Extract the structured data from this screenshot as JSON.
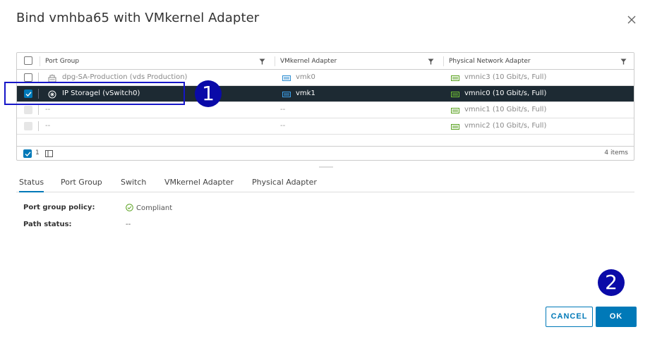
{
  "dialog": {
    "title": "Bind vmhba65 with VMkernel Adapter"
  },
  "grid": {
    "columns": [
      "Port Group",
      "VMkernel Adapter",
      "Physical Network Adapter"
    ],
    "rows": [
      {
        "port_group": "dpg-SA-Production (vds Production)",
        "vmkernel": "vmk0",
        "physical": "vmnic3 (10 Gbit/s, Full)",
        "checked": false,
        "selected": false,
        "disabled": false
      },
      {
        "port_group": "IP Storagel (vSwitch0)",
        "vmkernel": "vmk1",
        "physical": "vmnic0 (10 Gbit/s, Full)",
        "checked": true,
        "selected": true,
        "disabled": false
      },
      {
        "port_group": "--",
        "vmkernel": "--",
        "physical": "vmnic1 (10 Gbit/s, Full)",
        "checked": false,
        "selected": false,
        "disabled": true
      },
      {
        "port_group": "--",
        "vmkernel": "--",
        "physical": "vmnic2 (10 Gbit/s, Full)",
        "checked": false,
        "selected": false,
        "disabled": true
      }
    ],
    "footer": {
      "selected_count": "1",
      "total": "4 items"
    }
  },
  "tabs": [
    "Status",
    "Port Group",
    "Switch",
    "VMkernel Adapter",
    "Physical Adapter"
  ],
  "details": {
    "policy_label": "Port group policy:",
    "policy_value": "Compliant",
    "path_label": "Path status:",
    "path_value": "--"
  },
  "callouts": [
    "1",
    "2"
  ],
  "buttons": {
    "cancel": "CANCEL",
    "ok": "OK"
  },
  "colors": {
    "accent": "#0079b8",
    "selected_row": "#1d2a33",
    "callout": "#0a0aa8",
    "success": "#5aa220"
  }
}
